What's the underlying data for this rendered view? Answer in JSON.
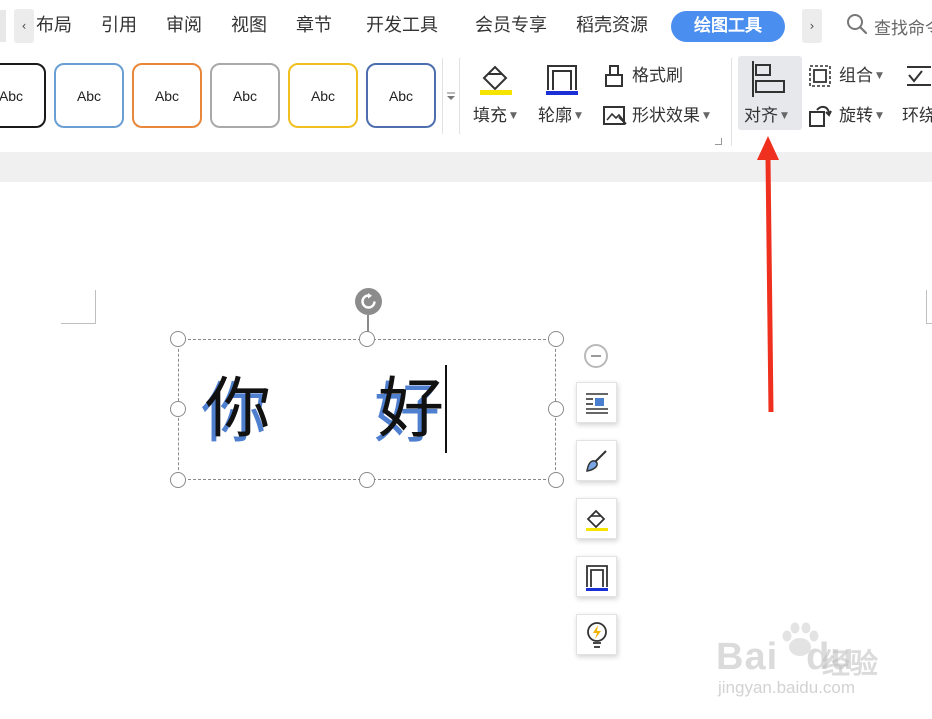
{
  "tabs": {
    "items": [
      {
        "label": "布局"
      },
      {
        "label": "引用"
      },
      {
        "label": "审阅"
      },
      {
        "label": "视图"
      },
      {
        "label": "章节"
      },
      {
        "label": "开发工具"
      },
      {
        "label": "会员专享"
      },
      {
        "label": "稻壳资源"
      }
    ],
    "active": "绘图工具",
    "scroll_left": "‹",
    "scroll_right": "›",
    "search_text": "查找命令"
  },
  "ribbon": {
    "style_gallery": [
      {
        "label": "Abc",
        "border": "#1a1a1a"
      },
      {
        "label": "Abc",
        "border": "#6a9fd4"
      },
      {
        "label": "Abc",
        "border": "#e8863a"
      },
      {
        "label": "Abc",
        "border": "#a9a9a9"
      },
      {
        "label": "Abc",
        "border": "#f0c020"
      },
      {
        "label": "Abc",
        "border": "#4d6fae"
      }
    ],
    "fill_label": "填充",
    "outline_label": "轮廓",
    "format_painter_label": "格式刷",
    "shape_effects_label": "形状效果",
    "align_label": "对齐",
    "group_label": "组合",
    "rotate_label": "旋转",
    "wrap_label": "环绕"
  },
  "document": {
    "text_chars": [
      "你",
      "好"
    ]
  },
  "watermark": {
    "logo_text": "Bai",
    "logo_text2": "du",
    "logo_cn": "经验",
    "url": "jingyan.baidu.com"
  },
  "colors": {
    "accent": "#4a8ef0",
    "arrow": "#f0301e",
    "text_shadow": "#4f7fcf",
    "fill_yellow": "#f5e400",
    "outline_blue": "#1c2fd6"
  }
}
